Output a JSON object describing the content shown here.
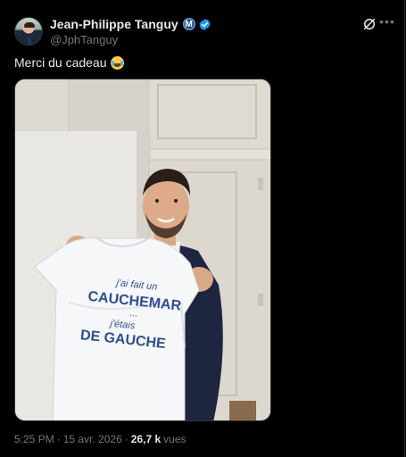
{
  "tweet": {
    "author_name": "Jean-Philippe Tanguy",
    "badge_letter": "M",
    "handle": "@JphTanguy",
    "text": "Merci du cadeau",
    "emoji": "face-with-tears-of-joy",
    "shirt_text": [
      "j'ai fait un",
      "CAUCHEMAR",
      "...",
      "j'étais",
      "DE GAUCHE"
    ],
    "time": "5:25 PM",
    "separator": "·",
    "date": "15 avr. 2026",
    "views_count": "26,7 k",
    "views_label": "vues"
  },
  "icons": {
    "verified": "verified-badge-icon",
    "grok": "grok-icon",
    "more": "more-icon"
  },
  "colors": {
    "background": "#000000",
    "text": "#e7e9ea",
    "secondary_text": "#71767b",
    "verified_blue": "#1d9bf0",
    "shirt_print": "#2d4f8f"
  }
}
